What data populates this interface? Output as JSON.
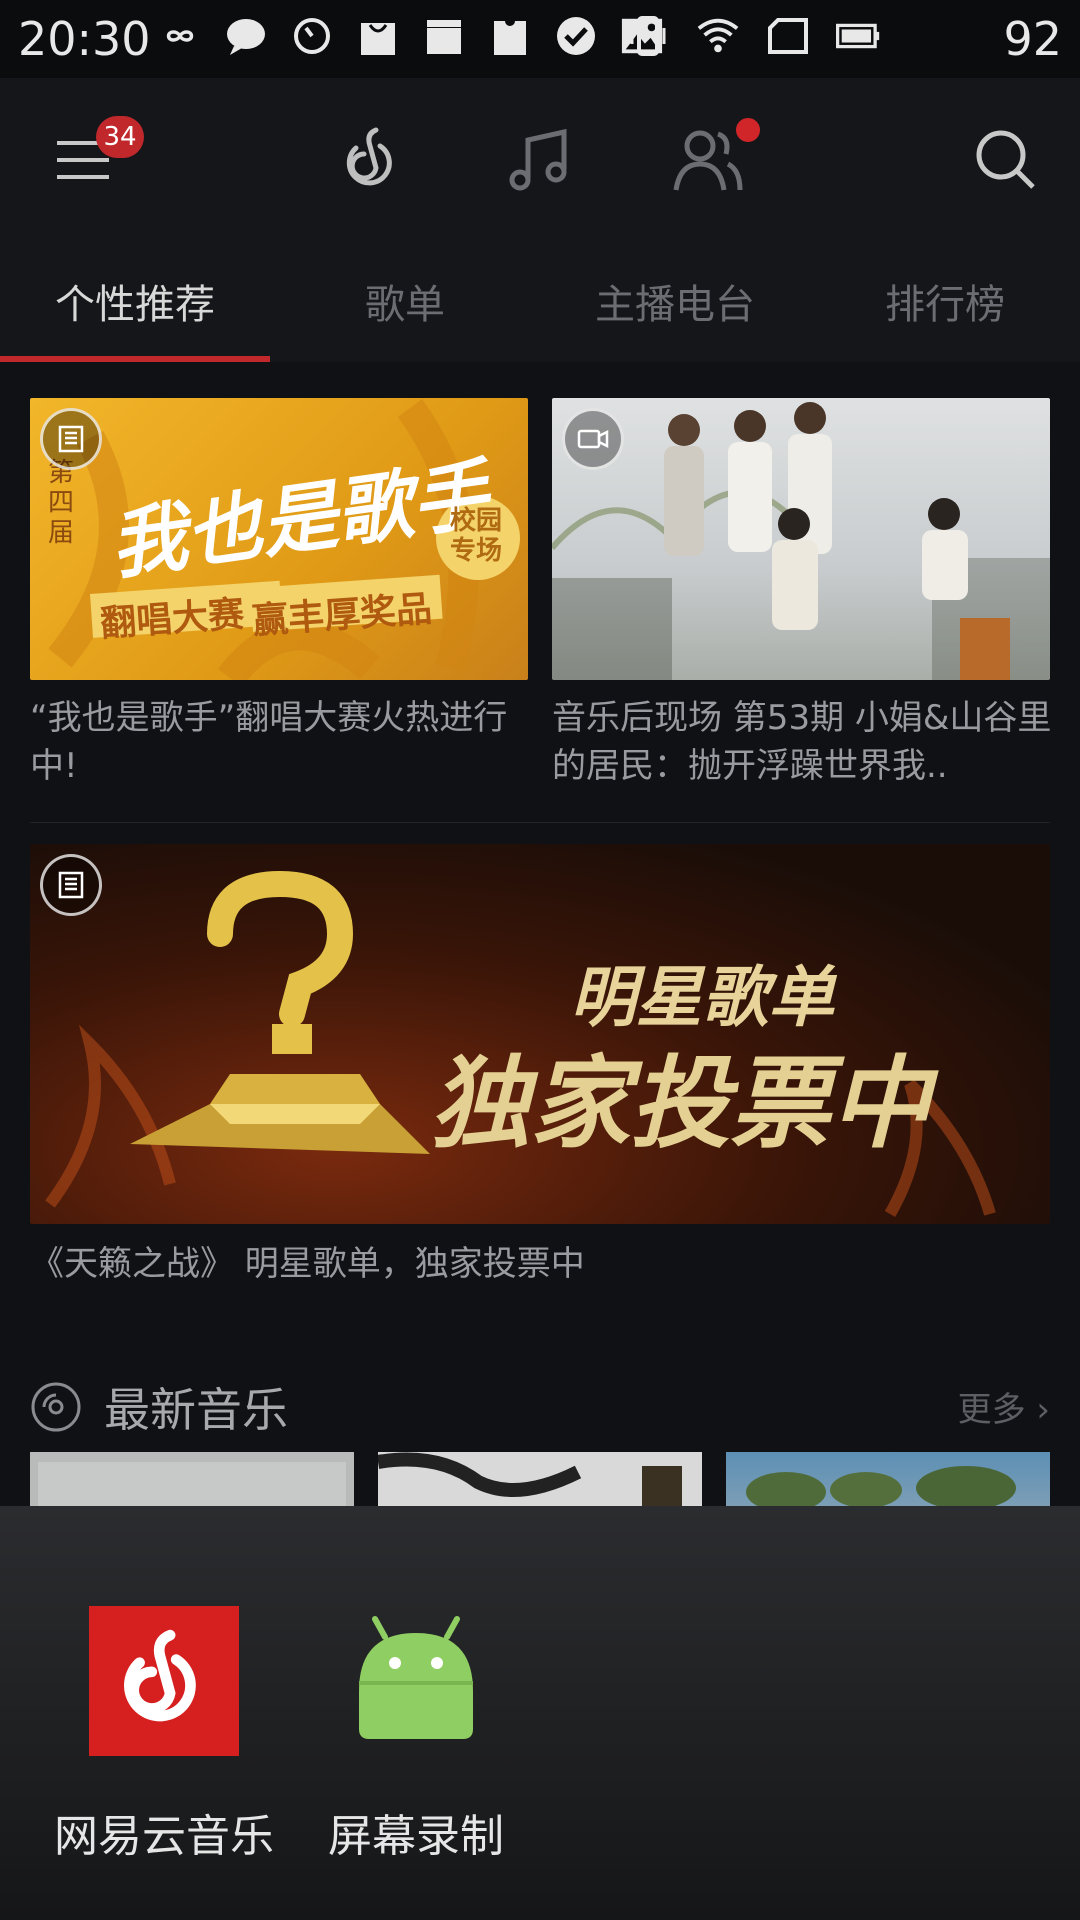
{
  "status_bar": {
    "time": "20:30",
    "battery_level": "92"
  },
  "top_nav": {
    "menu_badge_count": "34"
  },
  "tabs": [
    {
      "label": "个性推荐",
      "active": true
    },
    {
      "label": "歌单",
      "active": false
    },
    {
      "label": "主播电台",
      "active": false
    },
    {
      "label": "排行榜",
      "active": false
    }
  ],
  "banners": [
    {
      "type": "article",
      "title": "“我也是歌手”翻唱大赛火热进行中!",
      "image_text": [
        "第四届",
        "我也是歌手",
        "校园专场",
        "翻唱大赛",
        "赢丰厚奖品"
      ]
    },
    {
      "type": "video",
      "title": "音乐后现场 第53期 小娟&山谷里的居民：抛开浮躁世界我.."
    },
    {
      "type": "article",
      "title": "《天籁之战》 明星歌单，独家投票中",
      "image_text": [
        "明星歌单",
        "独家投票中"
      ]
    }
  ],
  "new_music": {
    "title": "最新音乐",
    "more_label": "更多"
  },
  "share_overlay": {
    "apps": [
      {
        "label": "网易云音乐",
        "icon": "netease-music-icon"
      },
      {
        "label": "屏幕录制",
        "icon": "android-icon"
      }
    ]
  },
  "colors": {
    "accent": "#c0282b",
    "background": "#101114",
    "nav_bg": "#15161a"
  }
}
